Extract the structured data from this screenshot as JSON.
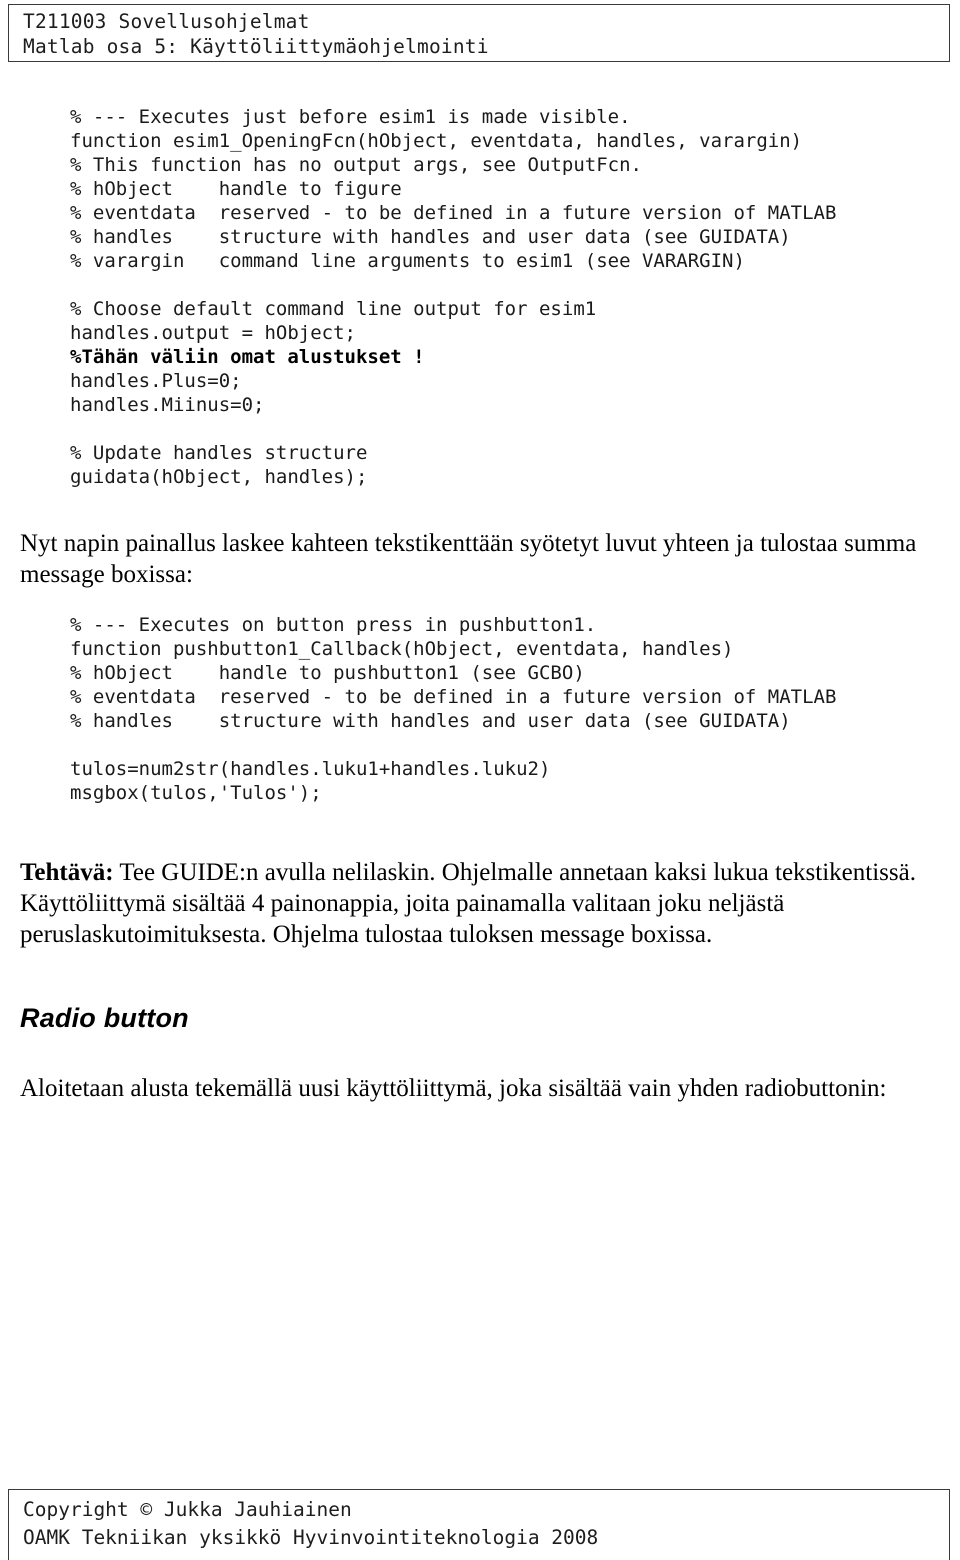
{
  "header": {
    "line1": "T211003 Sovellusohjelmat",
    "line2": "Matlab osa 5: Käyttöliittymäohjelmointi"
  },
  "code_opening": {
    "lines": [
      "% --- Executes just before esim1 is made visible.",
      "function esim1_OpeningFcn(hObject, eventdata, handles, varargin)",
      "% This function has no output args, see OutputFcn.",
      "% hObject    handle to figure",
      "% eventdata  reserved - to be defined in a future version of MATLAB",
      "% handles    structure with handles and user data (see GUIDATA)",
      "% varargin   command line arguments to esim1 (see VARARGIN)",
      "",
      "% Choose default command line output for esim1",
      "handles.output = hObject;",
      "%Tähän väliin omat alustukset !",
      "handles.Plus=0;",
      "handles.Miinus=0;",
      "",
      "% Update handles structure",
      "guidata(hObject, handles);"
    ],
    "bold_line_index": 10
  },
  "para_sum": {
    "text": "Nyt napin painallus laskee  kahteen tekstikenttään syötetyt luvut yhteen ja tulostaa summa message boxissa:"
  },
  "code_callback": {
    "lines": [
      "% --- Executes on button press in pushbutton1.",
      "function pushbutton1_Callback(hObject, eventdata, handles)",
      "% hObject    handle to pushbutton1 (see GCBO)",
      "% eventdata  reserved - to be defined in a future version of MATLAB",
      "% handles    structure with handles and user data (see GUIDATA)",
      "",
      "tulos=num2str(handles.luku1+handles.luku2)",
      "msgbox(tulos,'Tulos');"
    ]
  },
  "para_task": {
    "label": "Tehtävä:",
    "text": " Tee GUIDE:n avulla nelilaskin. Ohjelmalle annetaan kaksi lukua tekstikentissä. Käyttöliittymä sisältää 4 painonappia, joita painamalla valitaan joku neljästä peruslaskutoimituksesta. Ohjelma tulostaa tuloksen message boxissa."
  },
  "section_heading": {
    "text": "Radio button"
  },
  "para_radio_intro": {
    "text": "Aloitetaan alusta tekemällä uusi käyttöliittymä, joka sisältää vain yhden radiobuttonin:"
  },
  "footer": {
    "line1": "Copyright © Jukka Jauhiainen",
    "line2": "OAMK Tekniikan yksikkö Hyvinvointiteknologia 2008"
  }
}
